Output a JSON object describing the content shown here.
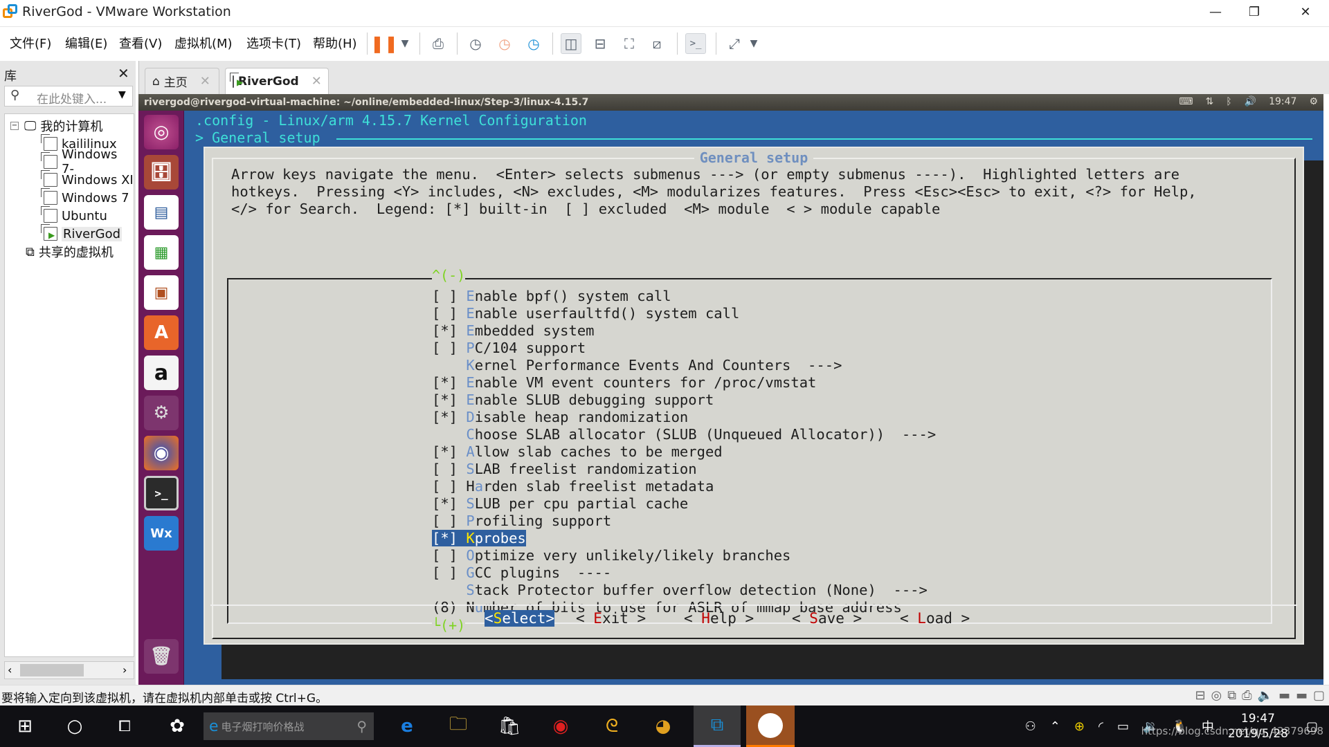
{
  "window": {
    "title": "RiverGod - VMware Workstation",
    "minimize": "—",
    "restore": "❐",
    "close": "✕"
  },
  "menubar": {
    "items": [
      {
        "label": "文件(F)"
      },
      {
        "label": "编辑(E)"
      },
      {
        "label": "查看(V)"
      },
      {
        "label": "虚拟机(M)"
      },
      {
        "label": "选项卡(T)"
      },
      {
        "label": "帮助(H)"
      }
    ],
    "toolbar_icons": [
      "pause-icon",
      "dropdown-icon",
      "send-ctrl-alt-del-icon",
      "snapshot-take-icon",
      "snapshot-revert-icon",
      "snapshot-manager-icon",
      "library-view-icon",
      "thumbnail-view-icon",
      "fullscreen-icon",
      "unity-icon",
      "console-view-icon",
      "stretch-icon",
      "dropdown-icon"
    ]
  },
  "library": {
    "title": "库",
    "close": "✕",
    "search_placeholder": "在此处键入...",
    "tree": [
      {
        "label": "我的计算机",
        "level": 0,
        "type": "computer"
      },
      {
        "label": "kaililinux",
        "level": 1,
        "type": "vm"
      },
      {
        "label": "Windows 7-",
        "level": 1,
        "type": "vm"
      },
      {
        "label": "Windows XI",
        "level": 1,
        "type": "vm"
      },
      {
        "label": "Windows 7",
        "level": 1,
        "type": "vm"
      },
      {
        "label": "Ubuntu",
        "level": 1,
        "type": "vm"
      },
      {
        "label": "RiverGod",
        "level": 1,
        "type": "vm-running",
        "selected": true
      },
      {
        "label": "共享的虚拟机",
        "level": 0,
        "type": "shared"
      }
    ]
  },
  "tabs": [
    {
      "label": "主页",
      "icon": "home-icon",
      "active": false
    },
    {
      "label": "RiverGod",
      "icon": "vm-running-icon",
      "active": true
    }
  ],
  "guest": {
    "terminal_title": "rivergod@rivergod-virtual-machine: ~/online/embedded-linux/Step-3/linux-4.15.7",
    "clock": "19:47",
    "launcher": [
      "ubuntu-dash-icon",
      "files-icon",
      "libreoffice-writer-icon",
      "libreoffice-calc-icon",
      "libreoffice-impress-icon",
      "software-center-icon",
      "amazon-icon",
      "system-settings-icon",
      "firefox-icon",
      "terminal-icon",
      "wxhexeditor-icon",
      "trash-icon"
    ],
    "menuconfig": {
      "title": ".config - Linux/arm 4.15.7 Kernel Configuration",
      "breadcrumb": "> General setup",
      "dialog_title": "General setup",
      "help": [
        "Arrow keys navigate the menu.  <Enter> selects submenus ---> (or empty submenus ----).  Highlighted letters are",
        "hotkeys.  Pressing <Y> includes, <N> excludes, <M> modularizes features.  Press <Esc><Esc> to exit, <?> for Help,",
        "</> for Search.  Legend: [*] built-in  [ ] excluded  <M> module  < > module capable"
      ],
      "scroll_up": "^(-)",
      "scroll_down": "└(+)",
      "items": [
        {
          "prefix": "[ ] ",
          "hotkey": "E",
          "rest": "nable bpf() system call"
        },
        {
          "prefix": "[ ] ",
          "hotkey": "E",
          "rest": "nable userfaultfd() system call"
        },
        {
          "prefix": "[*] ",
          "hotkey": "E",
          "rest": "mbedded system"
        },
        {
          "prefix": "[ ] ",
          "hotkey": "P",
          "rest": "C/104 support"
        },
        {
          "prefix": "    ",
          "hotkey": "K",
          "rest": "ernel Performance Events And Counters  --->"
        },
        {
          "prefix": "[*] ",
          "hotkey": "E",
          "rest": "nable VM event counters for /proc/vmstat"
        },
        {
          "prefix": "[*] ",
          "hotkey": "E",
          "rest": "nable SLUB debugging support"
        },
        {
          "prefix": "[*] ",
          "hotkey": "D",
          "rest": "isable heap randomization"
        },
        {
          "prefix": "    ",
          "hotkey": "C",
          "rest": "hoose SLAB allocator (SLUB (Unqueued Allocator))  --->"
        },
        {
          "prefix": "[*] ",
          "hotkey": "A",
          "rest": "llow slab caches to be merged"
        },
        {
          "prefix": "[ ] ",
          "hotkey": "S",
          "rest": "LAB freelist randomization"
        },
        {
          "prefix": "[ ] ",
          "hotkey": "a",
          "pre": "H",
          "rest": "rden slab freelist metadata"
        },
        {
          "prefix": "[*] ",
          "hotkey": "S",
          "rest": "LUB per cpu partial cache"
        },
        {
          "prefix": "[ ] ",
          "hotkey": "P",
          "rest": "rofiling support"
        },
        {
          "prefix": "[*] ",
          "hotkey": "K",
          "rest": "probes",
          "selected": true
        },
        {
          "prefix": "[ ] ",
          "hotkey": "O",
          "rest": "ptimize very unlikely/likely branches"
        },
        {
          "prefix": "[ ] ",
          "hotkey": "G",
          "rest": "CC plugins  ----"
        },
        {
          "prefix": "    ",
          "hotkey": "S",
          "rest": "tack Protector buffer overflow detection (None)  --->"
        },
        {
          "prefix": "(8) ",
          "pre": "N",
          "hotkey": "u",
          "rest": "mber of bits to use for ASLR of mmap base address"
        }
      ],
      "buttons": [
        {
          "pre": "<",
          "hotkey": "S",
          "rest": "elect>",
          "selected": true
        },
        {
          "pre": "< ",
          "hotkey": "E",
          "rest": "xit >"
        },
        {
          "pre": "< ",
          "hotkey": "H",
          "rest": "elp >"
        },
        {
          "pre": "< ",
          "hotkey": "S",
          "rest": "ave >"
        },
        {
          "pre": "< ",
          "hotkey": "L",
          "rest": "oad >"
        }
      ]
    }
  },
  "statusbar": {
    "text": "要将输入定向到该虚拟机，请在虚拟机内部单击或按 Ctrl+G。",
    "device_icons": [
      "hard-disk-icon",
      "cd-dvd-icon",
      "network-adapter-icon",
      "printer-icon",
      "sound-card-icon",
      "usb-icon",
      "usb-icon",
      "message-log-icon"
    ]
  },
  "taskbar": {
    "search_placeholder": "电子烟打响价格战",
    "apps": [
      "edge-icon",
      "file-explorer-icon",
      "store-icon",
      "netease-music-icon",
      "browser-icon",
      "chrome-icon",
      "vmware-icon",
      "avatar-app-icon"
    ],
    "ime": "中",
    "time": "19:47",
    "date": "2019/5/28",
    "watermark": "https://blog.csdn.net/qq_42379698"
  },
  "colors": {
    "terminal_bg": "#2e5f9f",
    "title_cyan": "#3ee0d8",
    "dialog_bg": "#d6d6d0",
    "hotkey_blue": "#6a8fc8",
    "button_hotkey_red": "#c00000",
    "selected_hotkey_yellow": "#ffe600",
    "scroll_green": "#7ed321",
    "launcher_bg": "#6b1a5a"
  }
}
